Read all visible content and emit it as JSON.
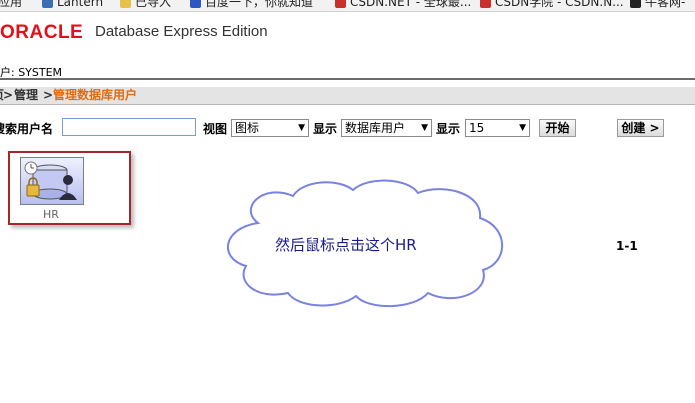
{
  "bookmarks": [
    {
      "label": "应用",
      "icon": "apps-icon"
    },
    {
      "label": "Lantern",
      "icon": "lantern-icon"
    },
    {
      "label": "已导入",
      "icon": "folder-icon"
    },
    {
      "label": "百度一下，你就知道",
      "icon": "baidu-icon"
    },
    {
      "label": "CSDN.NET - 全球最...",
      "icon": "csdn-icon"
    },
    {
      "label": "CSDN学院 - CSDN.N...",
      "icon": "csdn-icon"
    },
    {
      "label": "牛客网-",
      "icon": "nowcoder-icon"
    }
  ],
  "header": {
    "logo": "ORACLE",
    "product": "Database Express Edition",
    "user_label": "户: SYSTEM"
  },
  "breadcrumb": {
    "items": [
      "主页",
      "管理"
    ],
    "current": "管理数据库用户"
  },
  "toolbar": {
    "search_label": "搜索用户名",
    "search_value": "",
    "view_label": "视图",
    "view_value": "图标",
    "display_label": "显示",
    "display_value": "数据库用户",
    "show_label": "显示",
    "show_value": "15",
    "go_button": "开始",
    "create_button": "创建 >"
  },
  "users": [
    {
      "name": "HR"
    }
  ],
  "annotation": "然后鼠标点击这个HR",
  "pager": "1-1",
  "colors": {
    "brand_red": "#e3101a",
    "breadcrumb_current": "#e06c12",
    "highlight_box": "#a3282a",
    "annotation_stroke": "#7a82e0",
    "annotation_text": "#1a1a8a"
  }
}
